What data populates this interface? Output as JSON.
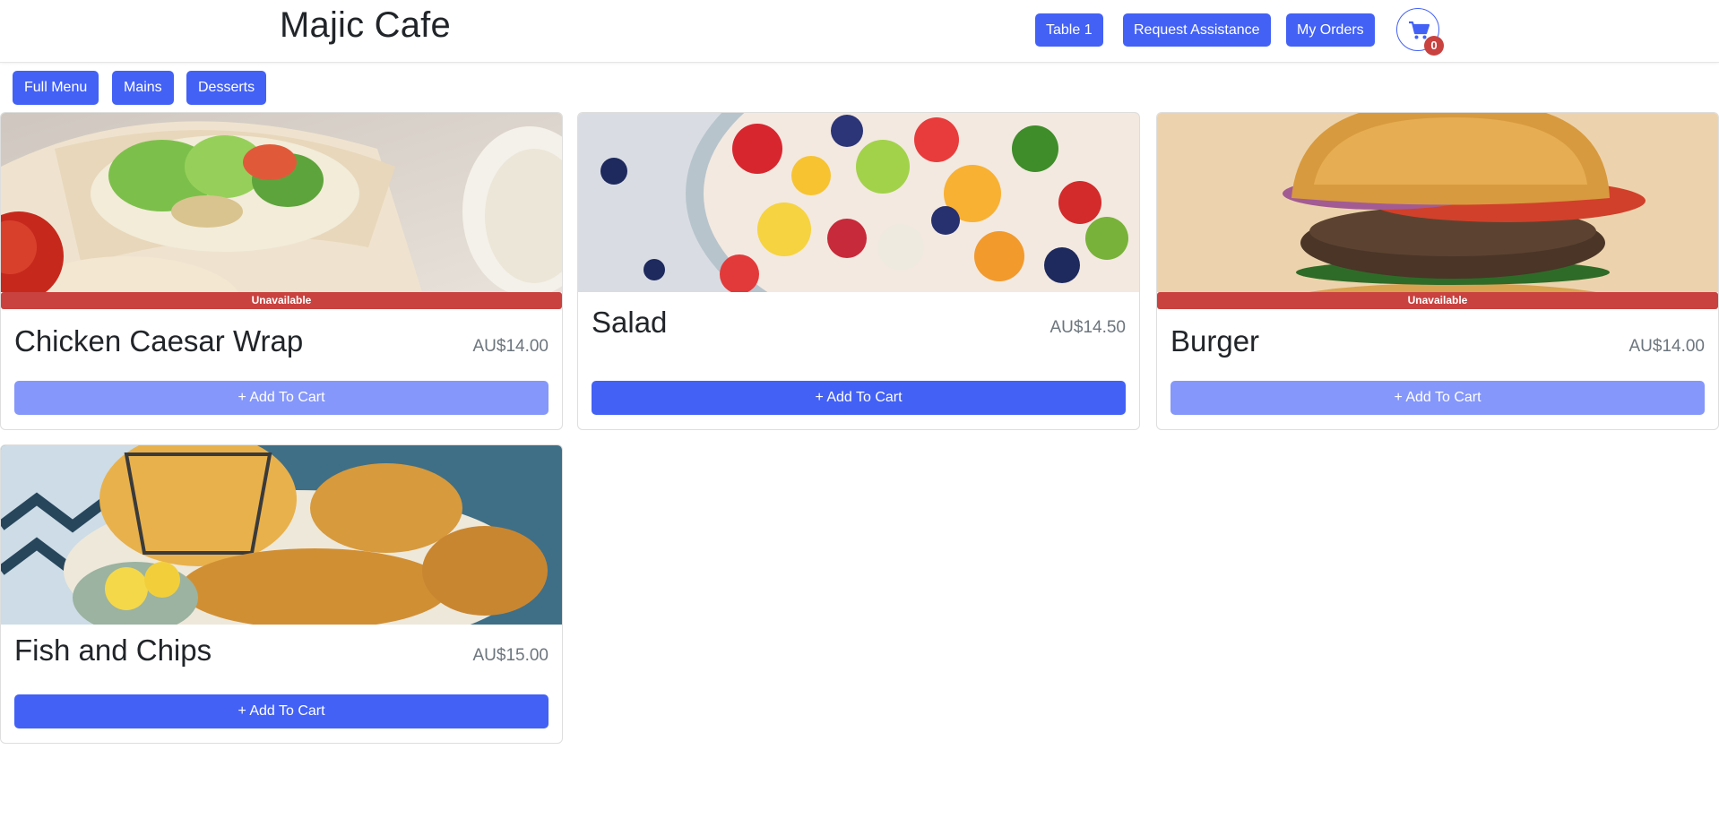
{
  "header": {
    "brand": "Majic Cafe",
    "table_label": "Table 1",
    "assistance_label": "Request Assistance",
    "orders_label": "My Orders",
    "cart_count": "0",
    "cart_icon": "shopping-cart-icon"
  },
  "categories": [
    "Full Menu",
    "Mains",
    "Desserts"
  ],
  "items": [
    {
      "name": "Chicken Caesar Wrap",
      "price": "AU$14.00",
      "status": "Unavailable",
      "button": "+ Add To Cart"
    },
    {
      "name": "Salad",
      "price": "AU$14.50",
      "status": "",
      "button": "+ Add To Cart"
    },
    {
      "name": "Burger",
      "price": "AU$14.00",
      "status": "Unavailable",
      "button": "+ Add To Cart"
    },
    {
      "name": "Fish and Chips",
      "price": "AU$15.00",
      "status": "",
      "button": "+ Add To Cart"
    }
  ],
  "colors": {
    "primary": "#4361f5",
    "primary_disabled": "#8597fa",
    "danger": "#c9423f",
    "muted_text": "#6c757d"
  }
}
